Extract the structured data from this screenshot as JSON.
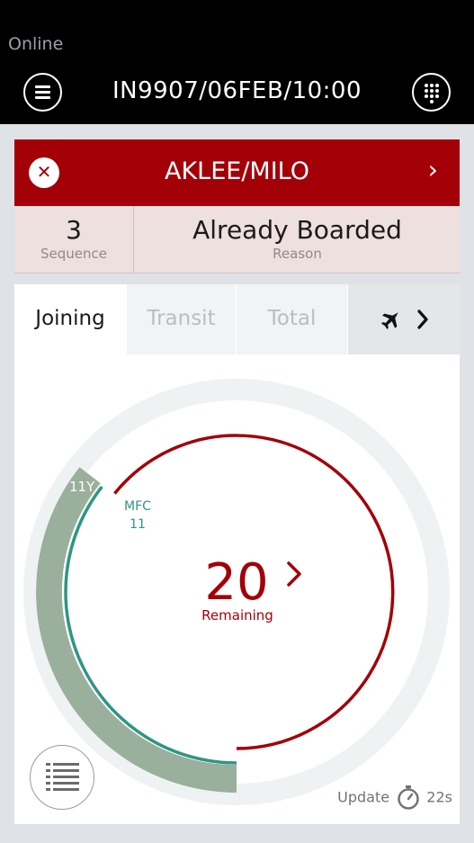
{
  "status_bar": {
    "network": "Online"
  },
  "header": {
    "flight_title": "IN9907/06FEB/10:00",
    "menu_icon": "hamburger-menu-icon",
    "grid_icon": "keypad-grid-icon"
  },
  "passenger": {
    "name": "AKLEE/MILO",
    "close_icon": "close-icon",
    "next_icon": "chevron-right-icon"
  },
  "info": {
    "sequence_value": "3",
    "sequence_label": "Sequence",
    "reason_value": "Already Boarded",
    "reason_label": "Reason"
  },
  "tabs": [
    {
      "label": "Joining",
      "active": true
    },
    {
      "label": "Transit",
      "active": false
    },
    {
      "label": "Total",
      "active": false
    },
    {
      "icon": "airplane-icon",
      "active": false
    }
  ],
  "gauge": {
    "remaining_count": "20",
    "remaining_label": "Remaining",
    "class_label": "11Y",
    "mfc_label": "MFC",
    "mfc_count": "11",
    "colors": {
      "remaining": "#a30008",
      "mfc": "#2e9683",
      "class": "#9aaf9c",
      "track": "#eef2f3"
    }
  },
  "footer": {
    "update_label": "Update",
    "update_value": "22s",
    "list_icon": "list-view-icon",
    "timer_icon": "stopwatch-icon"
  },
  "colors": {
    "brand_red": "#a30008",
    "header_bg": "#000000",
    "background": "#dfe3e7"
  }
}
